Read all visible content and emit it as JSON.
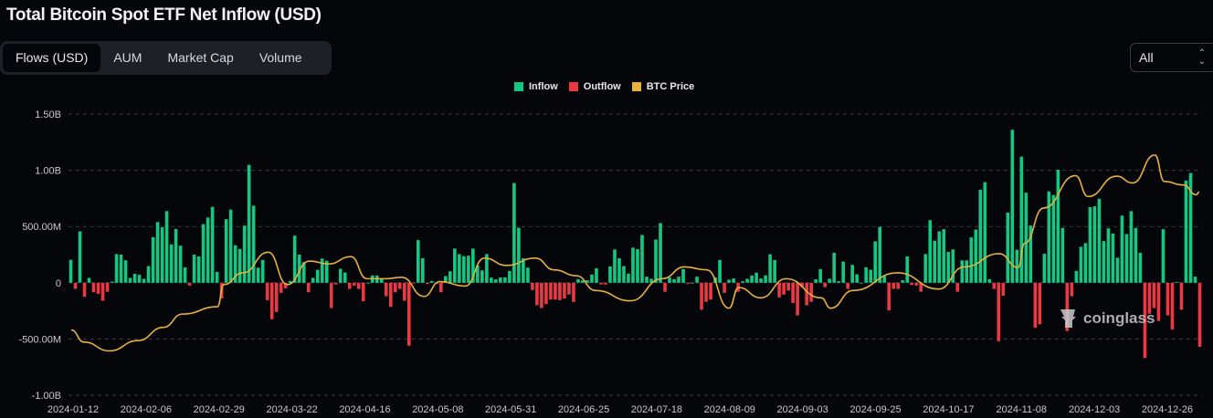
{
  "title": "Total Bitcoin Spot ETF Net Inflow (USD)",
  "tabs": [
    {
      "label": "Flows (USD)",
      "active": true
    },
    {
      "label": "AUM",
      "active": false
    },
    {
      "label": "Market Cap",
      "active": false
    },
    {
      "label": "Volume",
      "active": false
    }
  ],
  "range_select": {
    "value": "All"
  },
  "watermark": "coinglass",
  "colors": {
    "inflow": "#16c784",
    "outflow": "#ea3943",
    "price": "#f0b90b",
    "grid": "#3a3d44"
  },
  "chart_data": {
    "type": "bar",
    "title": "Total Bitcoin Spot ETF Net Inflow (USD)",
    "legend": [
      "Inflow",
      "Outflow",
      "BTC Price"
    ],
    "legend_position": "top-center",
    "y_ticks": [
      "1.50B",
      "1.00B",
      "500.00M",
      "0",
      "-500.00M",
      "-1.00B"
    ],
    "y_tick_values": [
      1500,
      1000,
      500,
      0,
      -500,
      -1000
    ],
    "ylim": [
      -1000,
      1500
    ],
    "y_unit": "USD millions",
    "grid": true,
    "x_ticks": [
      "2024-01-12",
      "2024-02-06",
      "2024-02-29",
      "2024-03-22",
      "2024-04-16",
      "2024-05-08",
      "2024-05-31",
      "2024-06-25",
      "2024-07-18",
      "2024-08-09",
      "2024-09-03",
      "2024-09-25",
      "2024-10-17",
      "2024-11-08",
      "2024-12-03",
      "2024-12-26"
    ],
    "flows": [
      204,
      -55,
      457,
      -125,
      43,
      -85,
      -100,
      -160,
      -80,
      10,
      255,
      250,
      200,
      43,
      80,
      70,
      35,
      148,
      405,
      540,
      495,
      637,
      341,
      478,
      330,
      137,
      -25,
      250,
      234,
      521,
      580,
      675,
      97,
      -140,
      565,
      650,
      333,
      300,
      508,
      1048,
      685,
      134,
      202,
      -155,
      -325,
      -260,
      -90,
      -50,
      16,
      419,
      250,
      183,
      -85,
      43,
      115,
      215,
      196,
      -225,
      -15,
      124,
      91,
      -55,
      -25,
      -55,
      -165,
      0,
      65,
      65,
      32,
      -120,
      -215,
      -85,
      -55,
      -160,
      -560,
      -5,
      379,
      218,
      -10,
      16,
      -10,
      -85,
      59,
      102,
      304,
      255,
      237,
      240,
      304,
      153,
      110,
      255,
      46,
      30,
      48,
      48,
      105,
      887,
      489,
      218,
      134,
      -65,
      -200,
      -225,
      -190,
      -150,
      -150,
      -155,
      -140,
      -105,
      -170,
      32,
      22,
      22,
      73,
      129,
      -15,
      -15,
      145,
      296,
      218,
      148,
      81,
      312,
      298,
      425,
      54,
      35,
      384,
      530,
      -80,
      46,
      32,
      54,
      121,
      -10,
      0,
      54,
      -240,
      -170,
      -150,
      48,
      202,
      -90,
      27,
      38,
      -80,
      13,
      35,
      65,
      89,
      38,
      65,
      253,
      202,
      -130,
      -105,
      -70,
      -180,
      -290,
      -40,
      -200,
      -170,
      30,
      121,
      -40,
      35,
      266,
      13,
      188,
      -55,
      159,
      75,
      0,
      137,
      116,
      368,
      497,
      62,
      -245,
      -55,
      -55,
      22,
      234,
      -20,
      -25,
      -80,
      255,
      556,
      374,
      457,
      476,
      274,
      296,
      -80,
      199,
      199,
      403,
      473,
      828,
      895,
      32,
      -55,
      -520,
      -115,
      624,
      1360,
      293,
      1121,
      801,
      508,
      -400,
      -370,
      258,
      812,
      780,
      1005,
      487,
      -430,
      -120,
      105,
      320,
      352,
      672,
      680,
      747,
      371,
      484,
      438,
      223,
      597,
      433,
      637,
      487,
      266,
      -670,
      -275,
      -225,
      -340,
      476,
      -290,
      -415,
      5,
      -240,
      909,
      976,
      54,
      -570
    ],
    "btc_price_usd_k": [
      [
        "2024-01-11",
        46.6
      ],
      [
        "2024-01-15",
        42.5
      ],
      [
        "2024-01-23",
        39.5
      ],
      [
        "2024-02-01",
        43
      ],
      [
        "2024-02-09",
        47.5
      ],
      [
        "2024-02-15",
        52
      ],
      [
        "2024-02-26",
        54.5
      ],
      [
        "2024-02-28",
        62
      ],
      [
        "2024-03-05",
        66
      ],
      [
        "2024-03-13",
        73
      ],
      [
        "2024-03-19",
        62
      ],
      [
        "2024-03-26",
        70
      ],
      [
        "2024-04-01",
        69
      ],
      [
        "2024-04-08",
        71.5
      ],
      [
        "2024-04-13",
        64
      ],
      [
        "2024-04-19",
        64
      ],
      [
        "2024-04-24",
        64.5
      ],
      [
        "2024-05-01",
        58
      ],
      [
        "2024-05-06",
        63
      ],
      [
        "2024-05-14",
        61.5
      ],
      [
        "2024-05-20",
        71
      ],
      [
        "2024-05-27",
        68.5
      ],
      [
        "2024-06-05",
        71
      ],
      [
        "2024-06-11",
        67
      ],
      [
        "2024-06-18",
        65
      ],
      [
        "2024-06-24",
        60
      ],
      [
        "2024-07-05",
        56.5
      ],
      [
        "2024-07-15",
        64
      ],
      [
        "2024-07-22",
        68
      ],
      [
        "2024-07-29",
        67
      ],
      [
        "2024-08-05",
        54
      ],
      [
        "2024-08-08",
        61
      ],
      [
        "2024-08-15",
        57.5
      ],
      [
        "2024-08-23",
        64
      ],
      [
        "2024-09-03",
        57.5
      ],
      [
        "2024-09-06",
        54
      ],
      [
        "2024-09-13",
        60
      ],
      [
        "2024-09-27",
        66
      ],
      [
        "2024-10-10",
        60.5
      ],
      [
        "2024-10-18",
        68
      ],
      [
        "2024-10-29",
        72.5
      ],
      [
        "2024-11-04",
        67.8
      ],
      [
        "2024-11-06",
        76
      ],
      [
        "2024-11-12",
        88
      ],
      [
        "2024-11-22",
        99
      ],
      [
        "2024-11-26",
        91.9
      ],
      [
        "2024-12-05",
        98.8
      ],
      [
        "2024-12-10",
        96.5
      ],
      [
        "2024-12-17",
        106
      ],
      [
        "2024-12-20",
        97
      ],
      [
        "2024-12-26",
        95.8
      ],
      [
        "2024-12-30",
        92.5
      ],
      [
        "2024-12-31",
        93.4
      ]
    ]
  }
}
